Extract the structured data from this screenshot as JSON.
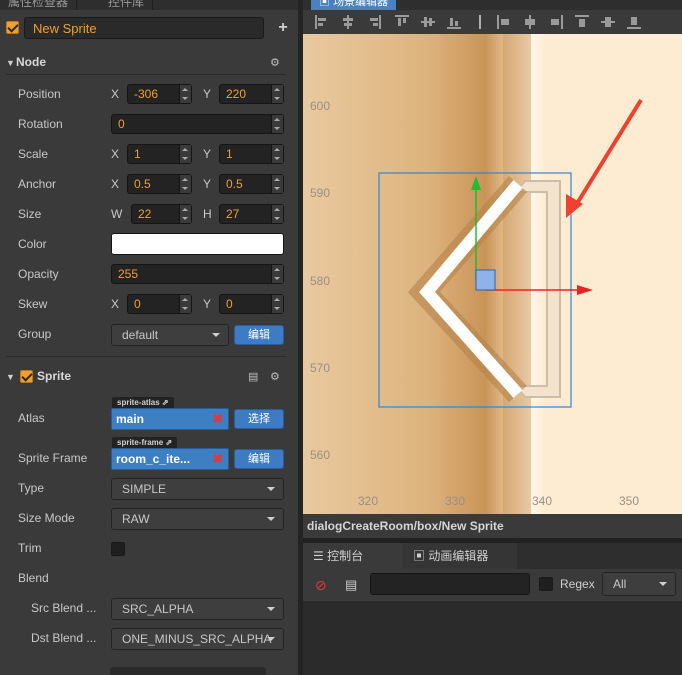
{
  "inspector": {
    "tabs": [
      "属性检查器",
      "控件库"
    ],
    "node_name": "New Sprite",
    "node_section": {
      "title": "Node"
    },
    "fields": {
      "position": {
        "label": "Position",
        "x_axis": "X",
        "x": "-306",
        "y_axis": "Y",
        "y": "220"
      },
      "rotation": {
        "label": "Rotation",
        "value": "0"
      },
      "scale": {
        "label": "Scale",
        "x_axis": "X",
        "x": "1",
        "y_axis": "Y",
        "y": "1"
      },
      "anchor": {
        "label": "Anchor",
        "x_axis": "X",
        "x": "0.5",
        "y_axis": "Y",
        "y": "0.5"
      },
      "size": {
        "label": "Size",
        "w_axis": "W",
        "w": "22",
        "h_axis": "H",
        "h": "27"
      },
      "color": {
        "label": "Color",
        "value": "#ffffff"
      },
      "opacity": {
        "label": "Opacity",
        "value": "255"
      },
      "skew": {
        "label": "Skew",
        "x_axis": "X",
        "x": "0",
        "y_axis": "Y",
        "y": "0"
      },
      "group": {
        "label": "Group",
        "value": "default",
        "edit_label": "编辑"
      }
    },
    "sprite_section": {
      "title": "Sprite",
      "atlas": {
        "label": "Atlas",
        "tag": "sprite-atlas",
        "value": "main",
        "button": "选择"
      },
      "sprite_frame": {
        "label": "Sprite Frame",
        "tag": "sprite-frame",
        "value": "room_c_ite...",
        "button": "编辑"
      },
      "type": {
        "label": "Type",
        "value": "SIMPLE"
      },
      "size_mode": {
        "label": "Size Mode",
        "value": "RAW"
      },
      "trim": {
        "label": "Trim",
        "checked": false
      },
      "blend": {
        "label": "Blend"
      },
      "src_blend": {
        "label": "Src Blend ...",
        "value": "SRC_ALPHA"
      },
      "dst_blend": {
        "label": "Dst Blend ...",
        "value": "ONE_MINUS_SRC_ALPHA"
      }
    }
  },
  "scene": {
    "tab": "场景编辑器",
    "y_ticks": [
      "600",
      "590",
      "580",
      "570",
      "560"
    ],
    "x_ticks": [
      "320",
      "330",
      "340",
      "350"
    ],
    "path": "dialogCreateRoom/box/New Sprite",
    "colors": {
      "bg": "#fdecd2",
      "border_dark": "#c48e54",
      "selection": "#2f86d6",
      "x_axis": "#ee2222",
      "y_axis": "#22bb33",
      "arrow": "#f04030"
    }
  },
  "console": {
    "tabs": [
      "控制台",
      "动画编辑器"
    ],
    "regex_label": "Regex",
    "filter_value": "All"
  }
}
